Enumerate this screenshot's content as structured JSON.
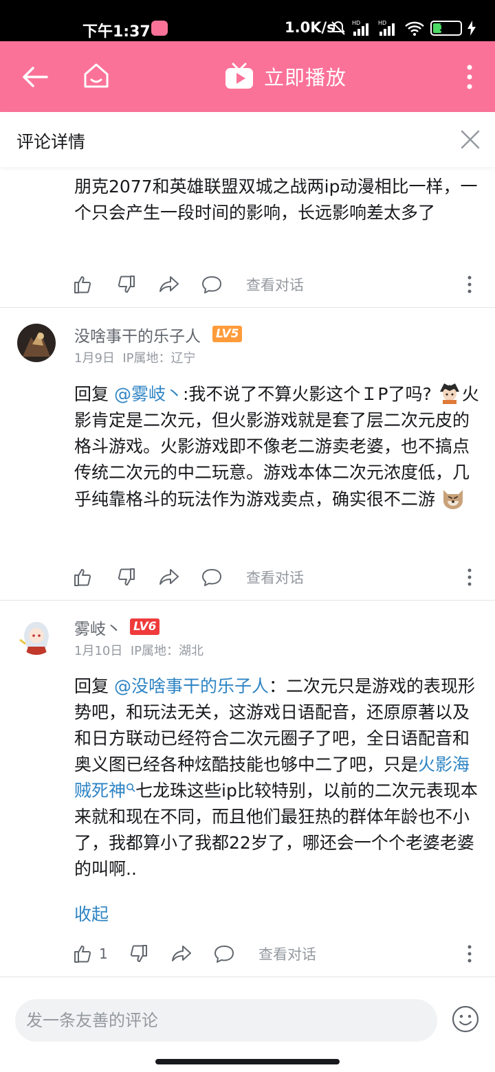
{
  "status_bar": {
    "time": "下午1:37",
    "net_speed": "1.0K/s",
    "battery": "32",
    "battery_fraction": 0.32
  },
  "topbar": {
    "play_label": "立即播放",
    "color": "#fb7299"
  },
  "sheet": {
    "title": "评论详情"
  },
  "comments": [
    {
      "text": "朋克2077和英雄联盟双城之战两ip动漫相比一样，一个只会产生一段时间的影响，长远影响差太多了",
      "action_label": "查看对话"
    },
    {
      "username": "没啥事干的乐子人",
      "level": "LV5",
      "date": "1月9日",
      "ip": "IP属地：辽宁",
      "reply_prefix": "回复",
      "mention": "@雾岐丶",
      "text_a": ":我不说了不算火影这个ＩP了吗?",
      "text_b": "火影肯定是二次元，但火影游戏就是套了层二次元皮的格斗游戏。火影游戏即不像老二游卖老婆，也不搞点传统二次元的中二玩意。游戏本体二次元浓度低，几乎纯靠格斗的玩法作为游戏卖点，确实很不二游",
      "action_label": "查看对话"
    },
    {
      "username": "雾岐丶",
      "level": "LV6",
      "date": "1月10日",
      "ip": "IP属地：湖北",
      "reply_prefix": "回复",
      "mention": "@没啥事干的乐子人",
      "text_a": "：二次元只是游戏的表现形势吧，和玩法无关，这游戏日语配音，还原原著以及和日方联动已经符合二次元圈子了吧，全日语配音和奥义图已经各种炫酷技能也够中二了吧，只是",
      "hashtag": "火影海贼死神",
      "text_b": "七龙珠这些ip比较特别，以前的二次元表现本来就和现在不同，而且他们最狂热的群体年龄也不小了，我都算小了我都22岁了，哪还会一个个老婆老婆的叫啊..",
      "collapse": "收起",
      "like_count": "1",
      "action_label": "查看对话"
    }
  ],
  "bottom": {
    "placeholder": "发一条友善的评论"
  }
}
